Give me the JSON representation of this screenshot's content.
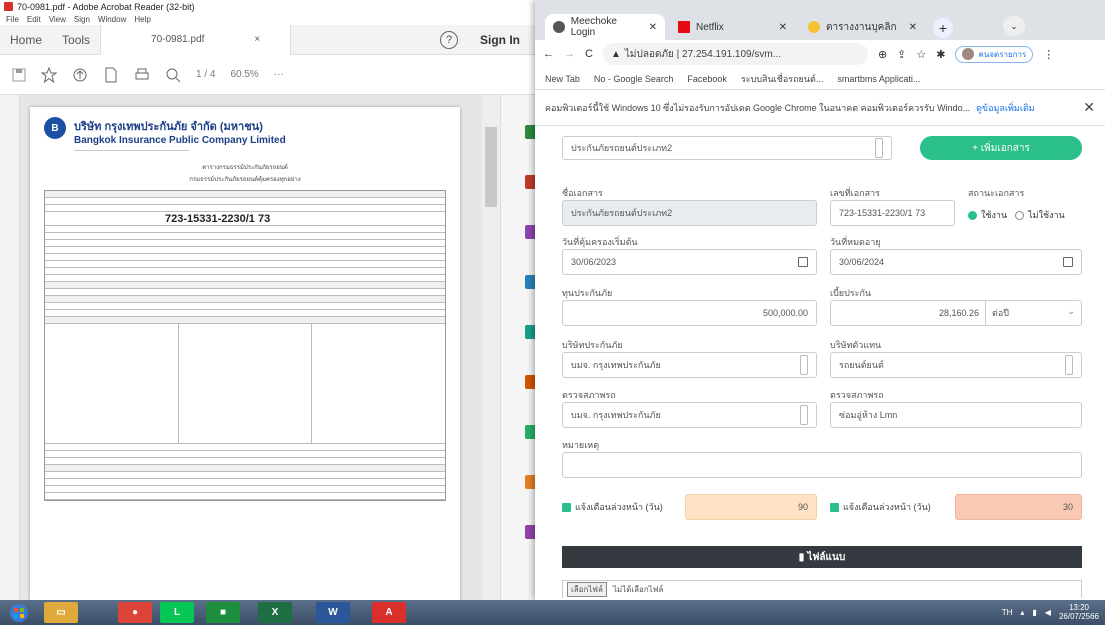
{
  "acrobat": {
    "window_title": "70-0981.pdf - Adobe Acrobat Reader (32-bit)",
    "menu": [
      "File",
      "Edit",
      "View",
      "Sign",
      "Window",
      "Help"
    ],
    "tabs": {
      "home": "Home",
      "tools": "Tools",
      "doc": "70-0981.pdf",
      "doc_close": "×"
    },
    "help": "?",
    "sign_in": "Sign In",
    "page_indicator": "1 / 4",
    "zoom": "60.5%",
    "more": "···"
  },
  "pdf": {
    "company_th": "บริษัท กรุงเทพประกันภัย จำกัด (มหาชน)",
    "company_en": "Bangkok Insurance Public Company Limited",
    "doc_title": "ตารางกรมธรรม์ประกันภัยรถยนต์",
    "doc_subtitle": "กรมธรรม์ประกันภัยรถยนต์คุ้มครองทุกอย่าง",
    "policy_number": "723-15331-2230/1 73"
  },
  "chrome": {
    "tabs": [
      {
        "label": "Meechoke Login",
        "color": "#555555"
      },
      {
        "label": "Netflix",
        "color": "#e50914"
      },
      {
        "label": "ตารางงานบุคลิก",
        "color": "#f4c430"
      }
    ],
    "url": "ไม่ปลอดภัย | 27.254.191.109/svm...",
    "profile": "คนจดรายการ",
    "bookmarks": [
      "New Tab",
      "No - Google Search",
      "Facebook",
      "ระบบสินเชื่อรถยนต์...",
      "smartbms Applicati..."
    ],
    "infobar_text": "คอมพิวเตอร์นี้ใช้ Windows 10 ซึ่งไม่รองรับการอัปเดต Google Chrome ในอนาคต คอมพิวเตอร์ควรรับ Windo...",
    "infobar_link": "ดูข้อมูลเพิ่มเติม",
    "infobar_close": "✕"
  },
  "form": {
    "top_input": "ประกันภัยรถยนต์ประเภท2",
    "add_button": "+ เพิ่มเอกสาร",
    "labels": {
      "type": "ชื่อเอกสาร",
      "policy_no": "เลขที่เอกสาร",
      "status": "สถานะเอกสาร",
      "start": "วันที่คุ้มครองเริ่มต้น",
      "end": "วันที่หมดอายุ",
      "insured": "ทุนประกันภัย",
      "premium": "เบี้ยประกัน",
      "insurer": "บริษัทประกันภัย",
      "broker": "บริษัทตัวแทน",
      "insurer_product": "ตรวจสภาพรถ",
      "garage": "ตรวจสภาพรถ",
      "note": "หมายเหตุ",
      "renew_left": "แจ้งเตือนล่วงหน้า (วัน)",
      "renew_right": "แจ้งเตือนล่วงหน้า (วัน)"
    },
    "type_value": "ประกันภัยรถยนต์ประเภท2",
    "policy_no_value": "723-15331-2230/1 73",
    "status_on": "ใช้งาน",
    "status_off": "ไม่ใช้งาน",
    "start_value": "30/06/2023",
    "end_value": "30/06/2024",
    "insured_value": "500,000.00",
    "premium_value": "28,160.26",
    "premium_unit": "ต่อปี",
    "insurer_value": "บมจ. กรุงเทพประกันภัย",
    "broker_value": "รถยนต์ยนต์",
    "insurer_product_value": "บมจ. กรุงเทพประกันภัย",
    "garage_value": "ซ่อมอู่ห้าง Lmn",
    "renew_left_value": "90",
    "renew_right_value": "30",
    "save_button": "ไฟล์แนบ",
    "file_label": "เลือกไฟล์",
    "file_name": "ไม่ได้เลือกไฟล์"
  },
  "taskbar": {
    "apps": [
      {
        "name": "explorer",
        "color": "#e0a93b",
        "glyph": "▭"
      },
      {
        "name": "chrome",
        "color": "#db4437",
        "glyph": "●"
      },
      {
        "name": "line",
        "color": "#06c755",
        "glyph": "L"
      },
      {
        "name": "meet",
        "color": "#1e8e3e",
        "glyph": "■"
      },
      {
        "name": "excel",
        "color": "#1d6f42",
        "glyph": "X"
      },
      {
        "name": "word",
        "color": "#2b579a",
        "glyph": "W"
      },
      {
        "name": "acrobat",
        "color": "#d9302c",
        "glyph": "A"
      }
    ],
    "lang": "TH",
    "time": "13:20",
    "date": "26/07/2566"
  },
  "colors": {
    "accent_green": "#2bbf8a",
    "renew_left_bg": "#fde2c4",
    "renew_right_bg": "#f9c9b6",
    "dark_button": "#343a40"
  }
}
